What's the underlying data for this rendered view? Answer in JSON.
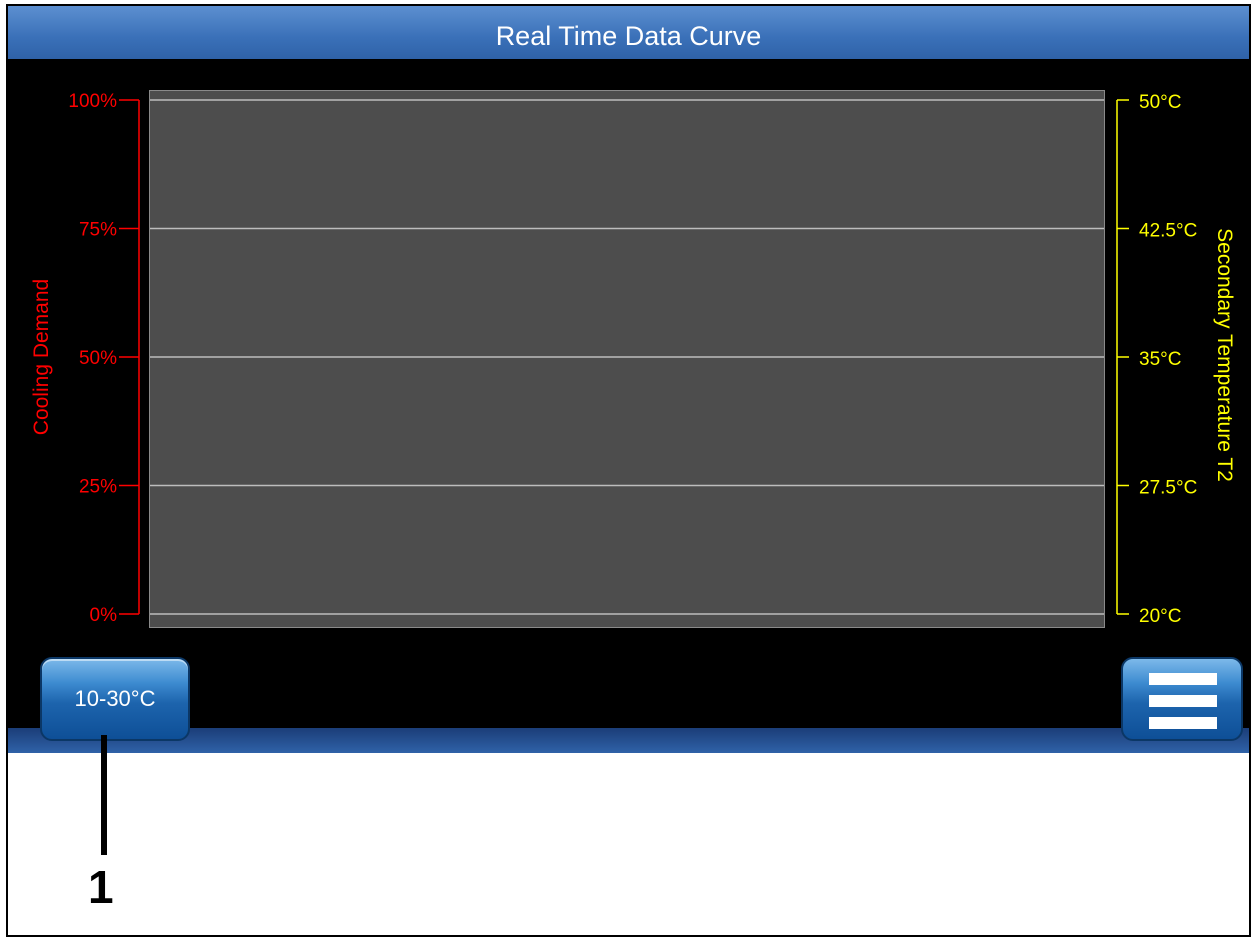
{
  "window": {
    "title": "Real Time Data Curve"
  },
  "chart_data": {
    "type": "line",
    "title": "",
    "left_axis": {
      "label": "Cooling Demand",
      "ticks": [
        "100%",
        "75%",
        "50%",
        "25%",
        "0%"
      ],
      "range": [
        0,
        100
      ],
      "color": "#ff0000"
    },
    "right_axis": {
      "label": "Secondary Temperature T2",
      "ticks": [
        "50°C",
        "42.5°C",
        "35°C",
        "27.5°C",
        "20°C"
      ],
      "range": [
        20,
        50
      ],
      "color": "#ffff00"
    },
    "grid": true,
    "series": []
  },
  "controls": {
    "range_button_label": "10-30°C",
    "menu_button_icon": "menu-icon"
  },
  "annotation": {
    "callout_number": "1"
  }
}
